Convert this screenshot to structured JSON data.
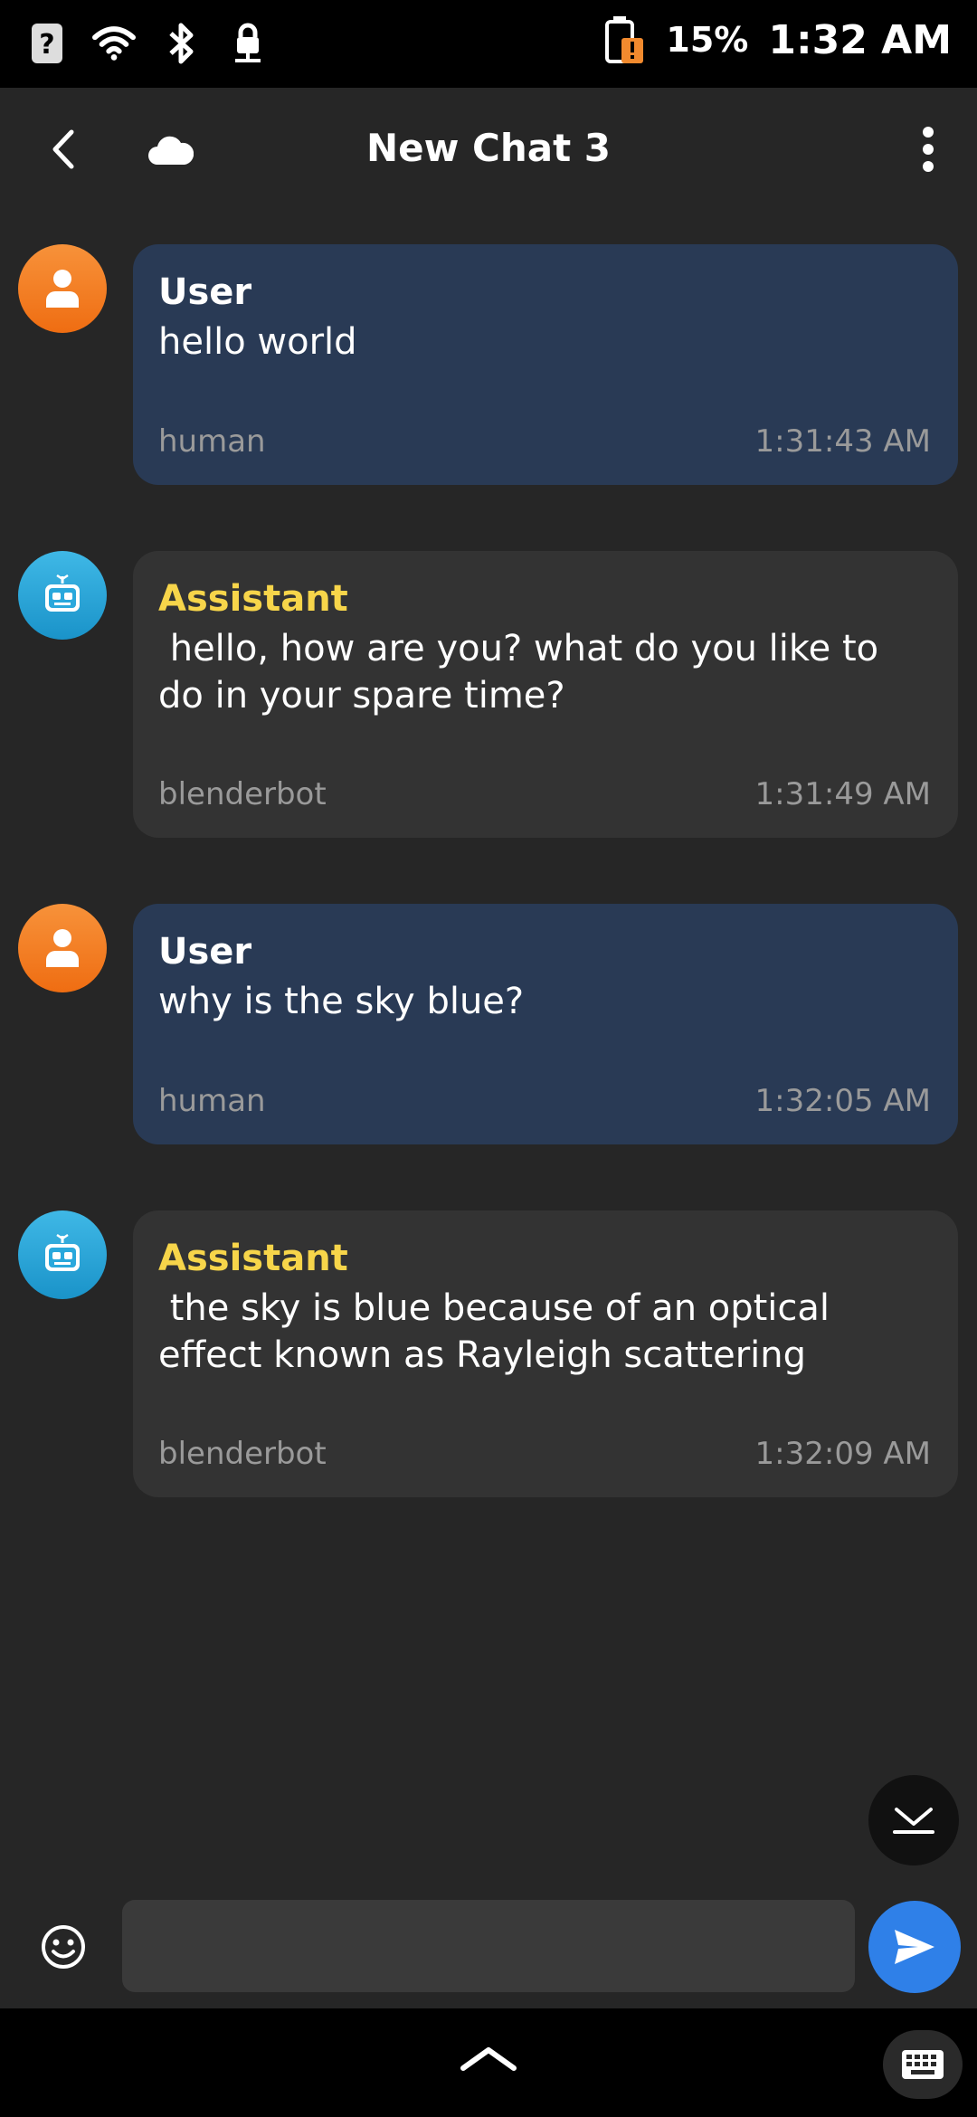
{
  "status_bar": {
    "battery_percent": "15%",
    "time": "1:32 AM",
    "icons": [
      "sim-unknown-icon",
      "wifi-icon",
      "bluetooth-icon",
      "vpn-lock-icon",
      "battery-alert-icon"
    ]
  },
  "app_bar": {
    "title": "New Chat 3",
    "icons": [
      "back-arrow-icon",
      "cloud-icon",
      "more-vert-icon"
    ]
  },
  "messages": [
    {
      "role": "user",
      "sender": "User",
      "text": "hello world",
      "source": "human",
      "time": "1:31:43 AM"
    },
    {
      "role": "bot",
      "sender": "Assistant",
      "text": " hello, how are you? what do you like to do in your spare time?",
      "source": "blenderbot",
      "time": "1:31:49 AM"
    },
    {
      "role": "user",
      "sender": "User",
      "text": "why is the sky blue?",
      "source": "human",
      "time": "1:32:05 AM"
    },
    {
      "role": "bot",
      "sender": "Assistant",
      "text": " the sky is blue because of an optical effect known as Rayleigh scattering",
      "source": "blenderbot",
      "time": "1:32:09 AM"
    }
  ],
  "composer": {
    "value": "",
    "placeholder": ""
  },
  "colors": {
    "user_bubble": "#293a55",
    "bot_bubble": "#333333",
    "assistant_name": "#f7d54a",
    "send_button": "#2f80e8",
    "user_avatar": "#f28a2e",
    "bot_avatar": "#2aa8dc"
  }
}
